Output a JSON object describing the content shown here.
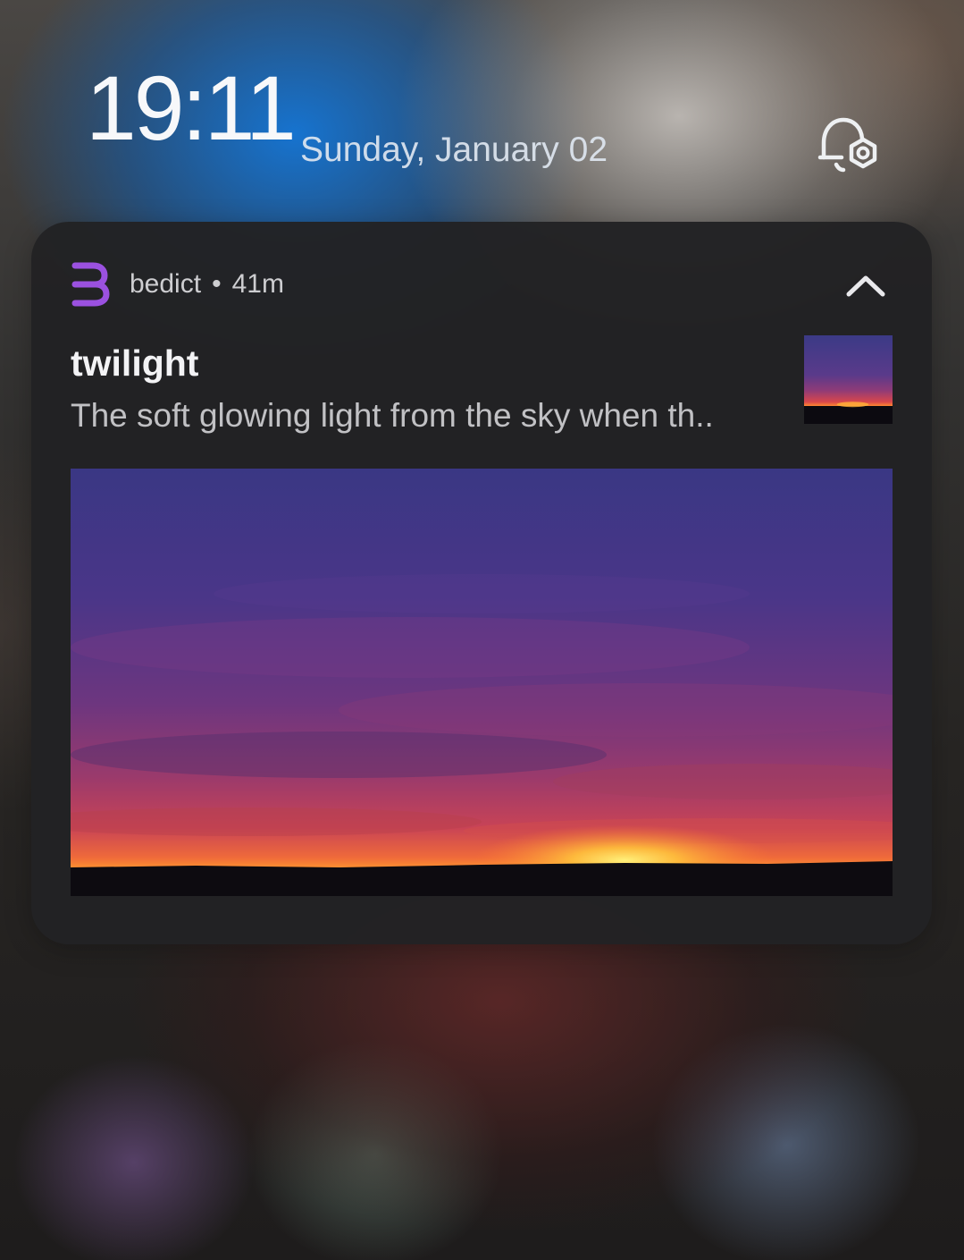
{
  "lockscreen": {
    "time": "19:11",
    "date": "Sunday, January 02",
    "notification_settings_icon": "bell-gear-icon"
  },
  "notification": {
    "app_name": "bedict",
    "separator": "•",
    "age": "41m",
    "app_icon": "bedict-logo-icon",
    "title": "twilight",
    "body": "The soft glowing light from the sky when th..",
    "collapse_icon": "chevron-up-icon",
    "image_alt": "twilight sky",
    "colors": {
      "accent": "#9b51e0",
      "card_background": "#222224"
    }
  }
}
